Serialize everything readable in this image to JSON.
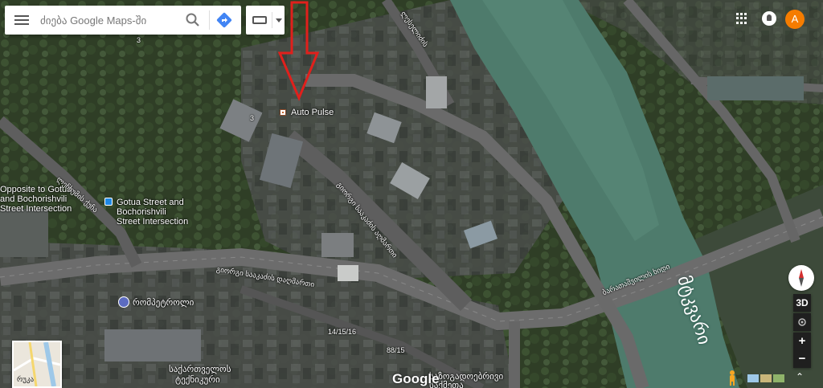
{
  "search": {
    "placeholder": "ძიება Google Maps-ში"
  },
  "labels": {
    "auto_pulse": "Auto Pulse",
    "opposite_gotua": "Opposite to Gotua",
    "and_bochorishvili": "and Bochorishvili",
    "street_intersection_left": "Street Intersection",
    "gotua_street": "Gotua Street and",
    "bochorishvili_street": "Bochorishvili",
    "street_intersection": "Street Intersection",
    "street_kazbegi": "ლესელიძის",
    "street_gotua_diag": "ლეჩხუმის ქუჩა",
    "street_saakadze_diag": "გიორგი სააკაძის აღმართი",
    "street_saakadze_desc": "გიორგი სააკაძის დაღმართი",
    "bridge": "ბარათაშვილის ხიდი",
    "river": "მტკვარი",
    "romi_petroli": "რომპეტროლი",
    "address_14": "14/15/16",
    "address_88": "88/15",
    "label_3a": "3",
    "label_3b": "3",
    "bottom_1": "საქართველოს",
    "bottom_2": "ტექნიკური",
    "bottom_3": "საზოგადოებრივი",
    "bottom_4": "საქმეთა",
    "minimap_label": "რუკა",
    "google": "Google"
  },
  "controls": {
    "avatar_letter": "A",
    "view_3d": "3D",
    "zoom_in": "+",
    "zoom_out": "−",
    "expand": "⌃"
  },
  "colors": {
    "avatar": "#f57c00",
    "arrow": "#e0201c",
    "river": "#4e7b6c",
    "road": "#6c6c6c"
  }
}
